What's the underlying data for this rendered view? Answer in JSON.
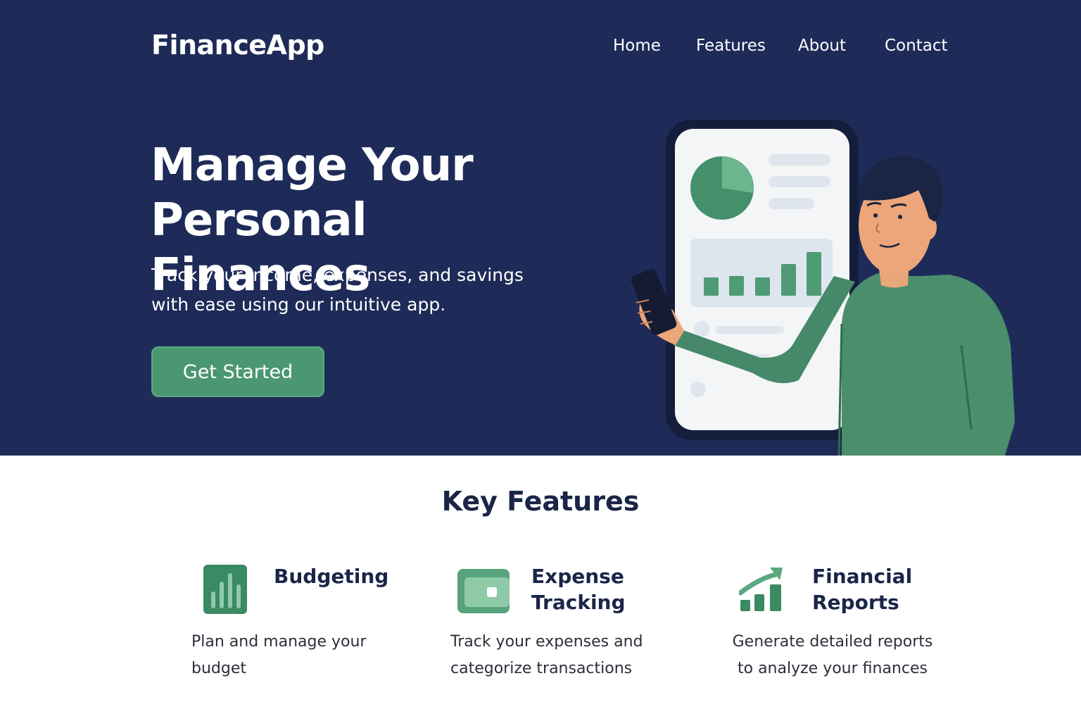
{
  "header": {
    "logo": "FinanceApp",
    "nav": [
      {
        "label": "Home"
      },
      {
        "label": "Features"
      },
      {
        "label": "About"
      },
      {
        "label": "Contact"
      }
    ]
  },
  "hero": {
    "title_line1": "Manage Your",
    "title_line2": "Personal Finances",
    "subtitle_line1": "Track your income, expenses, and savings",
    "subtitle_line2": "with ease using our intuitive app.",
    "cta_label": "Get Started"
  },
  "features": {
    "heading": "Key Features",
    "items": [
      {
        "name_line1": "Budgeting",
        "name_line2": "",
        "desc_line1": "Plan and manage your",
        "desc_line2": "budget",
        "icon": "bar-chart-icon"
      },
      {
        "name_line1": "Expense",
        "name_line2": "Tracking",
        "desc_line1": "Track your expenses and",
        "desc_line2": "categorize transactions",
        "icon": "wallet-icon"
      },
      {
        "name_line1": "Financial",
        "name_line2": "Reports",
        "desc_line1": "Generate detailed reports",
        "desc_line2": "to analyze your finances",
        "icon": "growth-chart-icon"
      }
    ]
  },
  "colors": {
    "hero_bg": "#1e2b58",
    "accent_green": "#4a9771",
    "heading_navy": "#1a2548"
  }
}
